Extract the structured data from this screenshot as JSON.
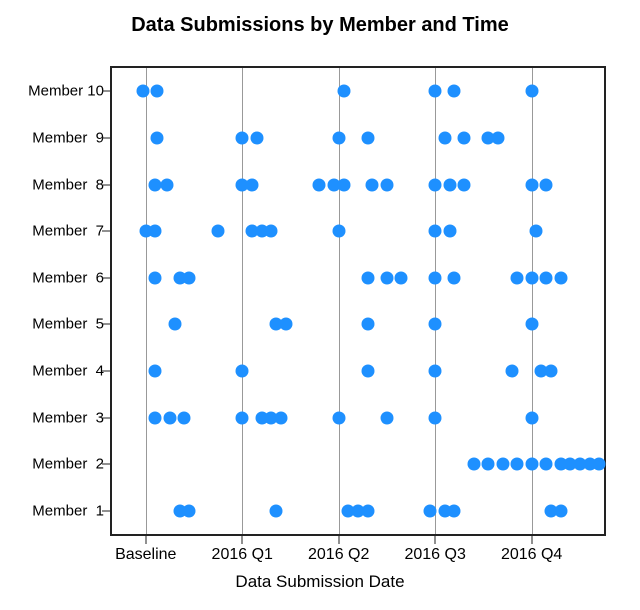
{
  "chart_data": {
    "type": "scatter",
    "title": "Data Submissions by Member and Time",
    "xlabel": "Data Submission Date",
    "ylabel": "",
    "x_ticks": [
      {
        "label": "Baseline",
        "pos": 0
      },
      {
        "label": "2016 Q1",
        "pos": 1
      },
      {
        "label": "2016 Q2",
        "pos": 2
      },
      {
        "label": "2016 Q3",
        "pos": 3
      },
      {
        "label": "2016 Q4",
        "pos": 4
      }
    ],
    "x_range": [
      -0.35,
      4.75
    ],
    "y_categories": [
      "Member  1",
      "Member  2",
      "Member  3",
      "Member  4",
      "Member  5",
      "Member  6",
      "Member  7",
      "Member  8",
      "Member  9",
      "Member 10"
    ],
    "series": [
      {
        "name": "Member  1",
        "x": [
          0.35,
          0.45,
          1.35,
          2.1,
          2.2,
          2.3,
          2.95,
          3.1,
          3.2,
          4.2,
          4.3
        ]
      },
      {
        "name": "Member  2",
        "x": [
          3.4,
          3.55,
          3.7,
          3.85,
          4.0,
          4.15,
          4.3,
          4.4,
          4.5,
          4.6,
          4.7
        ]
      },
      {
        "name": "Member  3",
        "x": [
          0.1,
          0.25,
          0.4,
          1.0,
          1.2,
          1.3,
          1.4,
          2.0,
          2.5,
          3.0,
          4.0
        ]
      },
      {
        "name": "Member  4",
        "x": [
          0.1,
          1.0,
          2.3,
          3.0,
          3.8,
          4.1,
          4.2
        ]
      },
      {
        "name": "Member  5",
        "x": [
          0.3,
          1.35,
          1.45,
          2.3,
          3.0,
          4.0
        ]
      },
      {
        "name": "Member  6",
        "x": [
          0.1,
          0.35,
          0.45,
          2.3,
          2.5,
          2.65,
          3.0,
          3.2,
          3.85,
          4.0,
          4.15,
          4.3
        ]
      },
      {
        "name": "Member  7",
        "x": [
          0.0,
          0.1,
          0.75,
          1.1,
          1.2,
          1.3,
          2.0,
          3.0,
          3.15,
          4.05
        ]
      },
      {
        "name": "Member  8",
        "x": [
          0.1,
          0.22,
          1.0,
          1.1,
          1.8,
          1.95,
          2.05,
          2.35,
          2.5,
          3.0,
          3.15,
          3.3,
          4.0,
          4.15
        ]
      },
      {
        "name": "Member  9",
        "x": [
          0.12,
          1.0,
          1.15,
          2.0,
          2.3,
          3.1,
          3.3,
          3.55,
          3.65
        ]
      },
      {
        "name": "Member 10",
        "x": [
          -0.03,
          0.12,
          2.05,
          3.0,
          3.2,
          4.0
        ]
      }
    ],
    "dot_color": "#1e90ff"
  }
}
